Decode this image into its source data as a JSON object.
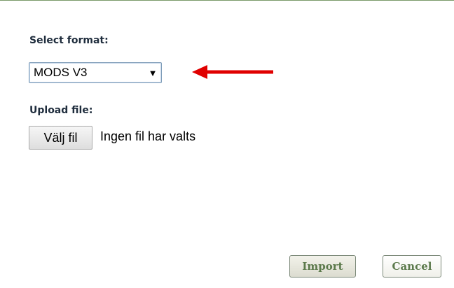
{
  "form": {
    "format_label": "Select format:",
    "format_selected": "MODS V3",
    "upload_label": "Upload file:",
    "file_button_label": "Välj fil",
    "file_status": "Ingen fil har valts"
  },
  "actions": {
    "import_label": "Import",
    "cancel_label": "Cancel"
  },
  "annotation": {
    "arrow_color": "#e00000",
    "arrow_icon": "left-arrow-icon"
  },
  "colors": {
    "button_text": "#5c7a4c",
    "label_text": "#1f2d3d",
    "top_border": "#7a9a6a"
  }
}
